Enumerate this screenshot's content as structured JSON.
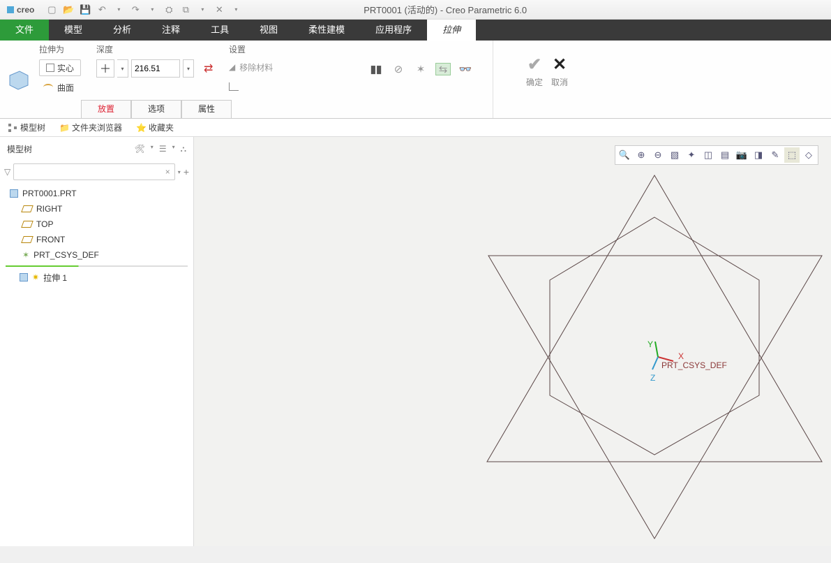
{
  "app": {
    "name": "creo",
    "title": "PRT0001 (活动的) - Creo Parametric 6.0"
  },
  "ribbon_tabs": {
    "file": "文件",
    "items": [
      "模型",
      "分析",
      "注释",
      "工具",
      "视图",
      "柔性建模",
      "应用程序"
    ],
    "active": "拉伸"
  },
  "ribbon": {
    "extrude_as": {
      "label": "拉伸为",
      "solid": "实心",
      "surface": "曲面"
    },
    "depth": {
      "label": "深度",
      "value": "216.51"
    },
    "settings": {
      "label": "设置",
      "remove_material": "移除材料"
    },
    "confirm": {
      "ok": "确定",
      "cancel": "取消"
    },
    "subtabs": {
      "placement": "放置",
      "options": "选项",
      "properties": "属性"
    }
  },
  "nav_tabs": {
    "model_tree": "模型树",
    "folder_browser": "文件夹浏览器",
    "favorites": "收藏夹"
  },
  "sidebar": {
    "header": "模型树",
    "root": "PRT0001.PRT",
    "planes": [
      "RIGHT",
      "TOP",
      "FRONT"
    ],
    "csys": "PRT_CSYS_DEF",
    "feature": "拉伸 1"
  },
  "canvas": {
    "axes": {
      "x": "X",
      "y": "Y",
      "z": "Z"
    },
    "csys_label": "PRT_CSYS_DEF"
  }
}
